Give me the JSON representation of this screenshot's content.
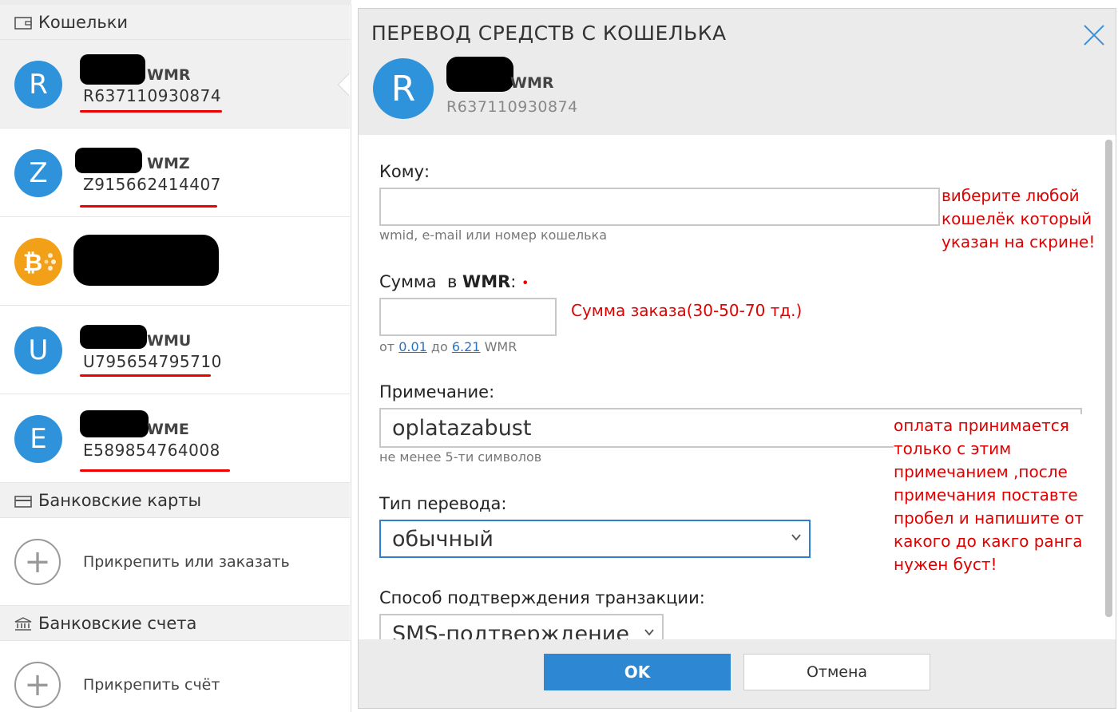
{
  "wallets_section": {
    "title": "Кошельки",
    "icon": "wallet-icon"
  },
  "wallets": [
    {
      "letter": "R",
      "type": "WMR",
      "number": "R637110930874",
      "color": "#2f93dc"
    },
    {
      "letter": "Z",
      "type": "WMZ",
      "number": "Z915662414407",
      "color": "#2f93dc"
    },
    {
      "letter": "",
      "type": "",
      "number": "",
      "color": "#f3a019",
      "icon": "bitcoin-icon"
    },
    {
      "letter": "U",
      "type": "WMU",
      "number": "U795654795710",
      "color": "#2f93dc"
    },
    {
      "letter": "E",
      "type": "WME",
      "number": "E589854764008",
      "color": "#2f93dc"
    }
  ],
  "cards_section": {
    "title": "Банковские карты",
    "icon": "card-icon",
    "add_label": "Прикрепить или заказать"
  },
  "accounts_section": {
    "title": "Банковские счета",
    "icon": "bank-icon",
    "add_label": "Прикрепить счёт"
  },
  "dialog": {
    "title": "ПЕРЕВОД СРЕДСТВ С КОШЕЛЬКА",
    "wallet_letter": "R",
    "wallet_type": "WMR",
    "wallet_number": "R637110930874",
    "to_label": "Кому:",
    "to_value": "",
    "to_hint": "wmid, e-mail или номер кошелька",
    "amount_label_prefix": "Сумма  в ",
    "amount_currency": "WMR",
    "amount_label_suffix": ":",
    "amount_required_mark": "•",
    "amount_value": "",
    "amount_hint_from": "от ",
    "amount_min": "0.01",
    "amount_hint_to": " до ",
    "amount_max": "6.21",
    "amount_hint_cur": " WMR",
    "note_label": "Примечание:",
    "note_value": "oplatazabust",
    "note_hint": "не менее 5-ти символов",
    "type_label": "Тип перевода:",
    "type_value": "обычный",
    "confirm_label": "Способ подтверждения транзакции:",
    "confirm_value": "SMS-подтверждение",
    "ok_label": "OK",
    "cancel_label": "Отмена"
  },
  "annotations": {
    "wallet_hint_lines": [
      "виберите любой",
      "кошелёк который",
      "указан на скрине!"
    ],
    "amount_hint": "Сумма заказа(30-50-70 тд.)",
    "note_hint_lines": [
      "оплата принимается",
      "только с этим",
      "примечанием ,после",
      "примечания поставте",
      "пробел и напишите от",
      "какого до какго ранга",
      "нужен буст!"
    ],
    "color": "#e00000"
  },
  "colors": {
    "accent": "#2f93dc",
    "ok_button": "#2d87d3",
    "bitcoin": "#f3a019",
    "annotation": "#e00000"
  }
}
